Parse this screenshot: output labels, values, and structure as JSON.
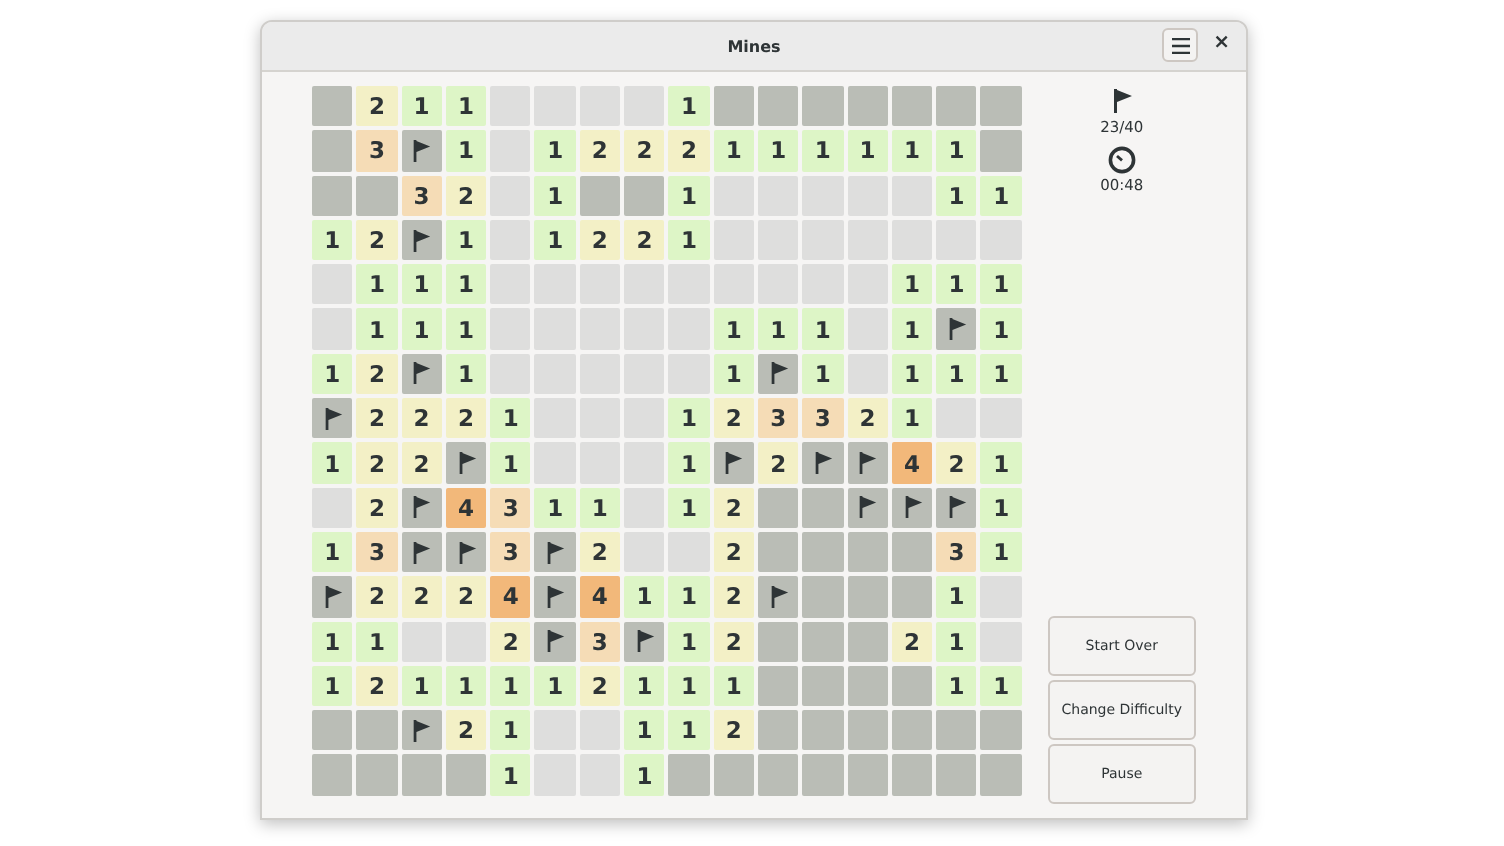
{
  "window": {
    "title": "Mines",
    "close": "×"
  },
  "board": {
    "rows": [
      [
        {
          "kind": "hidden"
        },
        {
          "kind": "number",
          "text": "2",
          "color": "#f3f0c6"
        },
        {
          "kind": "number",
          "text": "1",
          "color": "#ddf5c6"
        },
        {
          "kind": "number",
          "text": "1",
          "color": "#ddf5c6"
        },
        {
          "kind": "open"
        },
        {
          "kind": "open"
        },
        {
          "kind": "open"
        },
        {
          "kind": "open"
        },
        {
          "kind": "number",
          "text": "1",
          "color": "#ddf5c6"
        },
        {
          "kind": "hidden"
        },
        {
          "kind": "hidden"
        },
        {
          "kind": "hidden"
        },
        {
          "kind": "hidden"
        },
        {
          "kind": "hidden"
        },
        {
          "kind": "hidden"
        },
        {
          "kind": "hidden"
        }
      ],
      [
        {
          "kind": "hidden"
        },
        {
          "kind": "number",
          "text": "3",
          "color": "#f5dcb6"
        },
        {
          "kind": "flag"
        },
        {
          "kind": "number",
          "text": "1",
          "color": "#ddf5c6"
        },
        {
          "kind": "open"
        },
        {
          "kind": "number",
          "text": "1",
          "color": "#ddf5c6"
        },
        {
          "kind": "number",
          "text": "2",
          "color": "#f3f0c6"
        },
        {
          "kind": "number",
          "text": "2",
          "color": "#f3f0c6"
        },
        {
          "kind": "number",
          "text": "2",
          "color": "#f3f0c6"
        },
        {
          "kind": "number",
          "text": "1",
          "color": "#ddf5c6"
        },
        {
          "kind": "number",
          "text": "1",
          "color": "#ddf5c6"
        },
        {
          "kind": "number",
          "text": "1",
          "color": "#ddf5c6"
        },
        {
          "kind": "number",
          "text": "1",
          "color": "#ddf5c6"
        },
        {
          "kind": "number",
          "text": "1",
          "color": "#ddf5c6"
        },
        {
          "kind": "number",
          "text": "1",
          "color": "#ddf5c6"
        },
        {
          "kind": "hidden"
        }
      ],
      [
        {
          "kind": "hidden"
        },
        {
          "kind": "hidden"
        },
        {
          "kind": "number",
          "text": "3",
          "color": "#f5dcb6"
        },
        {
          "kind": "number",
          "text": "2",
          "color": "#f3f0c6"
        },
        {
          "kind": "open"
        },
        {
          "kind": "number",
          "text": "1",
          "color": "#ddf5c6"
        },
        {
          "kind": "hidden"
        },
        {
          "kind": "hidden"
        },
        {
          "kind": "number",
          "text": "1",
          "color": "#ddf5c6"
        },
        {
          "kind": "open"
        },
        {
          "kind": "open"
        },
        {
          "kind": "open"
        },
        {
          "kind": "open"
        },
        {
          "kind": "open"
        },
        {
          "kind": "number",
          "text": "1",
          "color": "#ddf5c6"
        },
        {
          "kind": "number",
          "text": "1",
          "color": "#ddf5c6"
        }
      ],
      [
        {
          "kind": "number",
          "text": "1",
          "color": "#ddf5c6"
        },
        {
          "kind": "number",
          "text": "2",
          "color": "#f3f0c6"
        },
        {
          "kind": "flag"
        },
        {
          "kind": "number",
          "text": "1",
          "color": "#ddf5c6"
        },
        {
          "kind": "open"
        },
        {
          "kind": "number",
          "text": "1",
          "color": "#ddf5c6"
        },
        {
          "kind": "number",
          "text": "2",
          "color": "#f3f0c6"
        },
        {
          "kind": "number",
          "text": "2",
          "color": "#f3f0c6"
        },
        {
          "kind": "number",
          "text": "1",
          "color": "#ddf5c6"
        },
        {
          "kind": "open"
        },
        {
          "kind": "open"
        },
        {
          "kind": "open"
        },
        {
          "kind": "open"
        },
        {
          "kind": "open"
        },
        {
          "kind": "open"
        },
        {
          "kind": "open"
        }
      ],
      [
        {
          "kind": "open"
        },
        {
          "kind": "number",
          "text": "1",
          "color": "#ddf5c6"
        },
        {
          "kind": "number",
          "text": "1",
          "color": "#ddf5c6"
        },
        {
          "kind": "number",
          "text": "1",
          "color": "#ddf5c6"
        },
        {
          "kind": "open"
        },
        {
          "kind": "open"
        },
        {
          "kind": "open"
        },
        {
          "kind": "open"
        },
        {
          "kind": "open"
        },
        {
          "kind": "open"
        },
        {
          "kind": "open"
        },
        {
          "kind": "open"
        },
        {
          "kind": "open"
        },
        {
          "kind": "number",
          "text": "1",
          "color": "#ddf5c6"
        },
        {
          "kind": "number",
          "text": "1",
          "color": "#ddf5c6"
        },
        {
          "kind": "number",
          "text": "1",
          "color": "#ddf5c6"
        }
      ],
      [
        {
          "kind": "open"
        },
        {
          "kind": "number",
          "text": "1",
          "color": "#ddf5c6"
        },
        {
          "kind": "number",
          "text": "1",
          "color": "#ddf5c6"
        },
        {
          "kind": "number",
          "text": "1",
          "color": "#ddf5c6"
        },
        {
          "kind": "open"
        },
        {
          "kind": "open"
        },
        {
          "kind": "open"
        },
        {
          "kind": "open"
        },
        {
          "kind": "open"
        },
        {
          "kind": "number",
          "text": "1",
          "color": "#ddf5c6"
        },
        {
          "kind": "number",
          "text": "1",
          "color": "#ddf5c6"
        },
        {
          "kind": "number",
          "text": "1",
          "color": "#ddf5c6"
        },
        {
          "kind": "open"
        },
        {
          "kind": "number",
          "text": "1",
          "color": "#ddf5c6"
        },
        {
          "kind": "flag"
        },
        {
          "kind": "number",
          "text": "1",
          "color": "#ddf5c6"
        }
      ],
      [
        {
          "kind": "number",
          "text": "1",
          "color": "#ddf5c6"
        },
        {
          "kind": "number",
          "text": "2",
          "color": "#f3f0c6"
        },
        {
          "kind": "flag"
        },
        {
          "kind": "number",
          "text": "1",
          "color": "#ddf5c6"
        },
        {
          "kind": "open"
        },
        {
          "kind": "open"
        },
        {
          "kind": "open"
        },
        {
          "kind": "open"
        },
        {
          "kind": "open"
        },
        {
          "kind": "number",
          "text": "1",
          "color": "#ddf5c6"
        },
        {
          "kind": "flag"
        },
        {
          "kind": "number",
          "text": "1",
          "color": "#ddf5c6"
        },
        {
          "kind": "open"
        },
        {
          "kind": "number",
          "text": "1",
          "color": "#ddf5c6"
        },
        {
          "kind": "number",
          "text": "1",
          "color": "#ddf5c6"
        },
        {
          "kind": "number",
          "text": "1",
          "color": "#ddf5c6"
        }
      ],
      [
        {
          "kind": "flag"
        },
        {
          "kind": "number",
          "text": "2",
          "color": "#f3f0c6"
        },
        {
          "kind": "number",
          "text": "2",
          "color": "#f3f0c6"
        },
        {
          "kind": "number",
          "text": "2",
          "color": "#f3f0c6"
        },
        {
          "kind": "number",
          "text": "1",
          "color": "#ddf5c6"
        },
        {
          "kind": "open"
        },
        {
          "kind": "open"
        },
        {
          "kind": "open"
        },
        {
          "kind": "number",
          "text": "1",
          "color": "#ddf5c6"
        },
        {
          "kind": "number",
          "text": "2",
          "color": "#f3f0c6"
        },
        {
          "kind": "number",
          "text": "3",
          "color": "#f5dcb6"
        },
        {
          "kind": "number",
          "text": "3",
          "color": "#f5dcb6"
        },
        {
          "kind": "number",
          "text": "2",
          "color": "#f3f0c6"
        },
        {
          "kind": "number",
          "text": "1",
          "color": "#ddf5c6"
        },
        {
          "kind": "open"
        },
        {
          "kind": "open"
        }
      ],
      [
        {
          "kind": "number",
          "text": "1",
          "color": "#ddf5c6"
        },
        {
          "kind": "number",
          "text": "2",
          "color": "#f3f0c6"
        },
        {
          "kind": "number",
          "text": "2",
          "color": "#f3f0c6"
        },
        {
          "kind": "flag"
        },
        {
          "kind": "number",
          "text": "1",
          "color": "#ddf5c6"
        },
        {
          "kind": "open"
        },
        {
          "kind": "open"
        },
        {
          "kind": "open"
        },
        {
          "kind": "number",
          "text": "1",
          "color": "#ddf5c6"
        },
        {
          "kind": "flag"
        },
        {
          "kind": "number",
          "text": "2",
          "color": "#f3f0c6"
        },
        {
          "kind": "flag"
        },
        {
          "kind": "flag"
        },
        {
          "kind": "number",
          "text": "4",
          "color": "#f2b87a"
        },
        {
          "kind": "number",
          "text": "2",
          "color": "#f3f0c6"
        },
        {
          "kind": "number",
          "text": "1",
          "color": "#ddf5c6"
        }
      ],
      [
        {
          "kind": "open"
        },
        {
          "kind": "number",
          "text": "2",
          "color": "#f3f0c6"
        },
        {
          "kind": "flag"
        },
        {
          "kind": "number",
          "text": "4",
          "color": "#f2b87a"
        },
        {
          "kind": "number",
          "text": "3",
          "color": "#f5dcb6"
        },
        {
          "kind": "number",
          "text": "1",
          "color": "#ddf5c6"
        },
        {
          "kind": "number",
          "text": "1",
          "color": "#ddf5c6"
        },
        {
          "kind": "open"
        },
        {
          "kind": "number",
          "text": "1",
          "color": "#ddf5c6"
        },
        {
          "kind": "number",
          "text": "2",
          "color": "#f3f0c6"
        },
        {
          "kind": "hidden"
        },
        {
          "kind": "hidden"
        },
        {
          "kind": "flag"
        },
        {
          "kind": "flag"
        },
        {
          "kind": "flag"
        },
        {
          "kind": "number",
          "text": "1",
          "color": "#ddf5c6"
        }
      ],
      [
        {
          "kind": "number",
          "text": "1",
          "color": "#ddf5c6"
        },
        {
          "kind": "number",
          "text": "3",
          "color": "#f5dcb6"
        },
        {
          "kind": "flag"
        },
        {
          "kind": "flag"
        },
        {
          "kind": "number",
          "text": "3",
          "color": "#f5dcb6"
        },
        {
          "kind": "flag"
        },
        {
          "kind": "number",
          "text": "2",
          "color": "#f3f0c6"
        },
        {
          "kind": "open"
        },
        {
          "kind": "open"
        },
        {
          "kind": "number",
          "text": "2",
          "color": "#f3f0c6"
        },
        {
          "kind": "hidden"
        },
        {
          "kind": "hidden"
        },
        {
          "kind": "hidden"
        },
        {
          "kind": "hidden"
        },
        {
          "kind": "number",
          "text": "3",
          "color": "#f5dcb6"
        },
        {
          "kind": "number",
          "text": "1",
          "color": "#ddf5c6"
        }
      ],
      [
        {
          "kind": "flag"
        },
        {
          "kind": "number",
          "text": "2",
          "color": "#f3f0c6"
        },
        {
          "kind": "number",
          "text": "2",
          "color": "#f3f0c6"
        },
        {
          "kind": "number",
          "text": "2",
          "color": "#f3f0c6"
        },
        {
          "kind": "number",
          "text": "4",
          "color": "#f2b87a"
        },
        {
          "kind": "flag"
        },
        {
          "kind": "number",
          "text": "4",
          "color": "#f2b87a"
        },
        {
          "kind": "number",
          "text": "1",
          "color": "#ddf5c6"
        },
        {
          "kind": "number",
          "text": "1",
          "color": "#ddf5c6"
        },
        {
          "kind": "number",
          "text": "2",
          "color": "#f3f0c6"
        },
        {
          "kind": "flag"
        },
        {
          "kind": "hidden"
        },
        {
          "kind": "hidden"
        },
        {
          "kind": "hidden"
        },
        {
          "kind": "number",
          "text": "1",
          "color": "#ddf5c6"
        },
        {
          "kind": "open"
        }
      ],
      [
        {
          "kind": "number",
          "text": "1",
          "color": "#ddf5c6"
        },
        {
          "kind": "number",
          "text": "1",
          "color": "#ddf5c6"
        },
        {
          "kind": "open"
        },
        {
          "kind": "open"
        },
        {
          "kind": "number",
          "text": "2",
          "color": "#f3f0c6"
        },
        {
          "kind": "flag"
        },
        {
          "kind": "number",
          "text": "3",
          "color": "#f5dcb6"
        },
        {
          "kind": "flag"
        },
        {
          "kind": "number",
          "text": "1",
          "color": "#ddf5c6"
        },
        {
          "kind": "number",
          "text": "2",
          "color": "#f3f0c6"
        },
        {
          "kind": "hidden"
        },
        {
          "kind": "hidden"
        },
        {
          "kind": "hidden"
        },
        {
          "kind": "number",
          "text": "2",
          "color": "#f3f0c6"
        },
        {
          "kind": "number",
          "text": "1",
          "color": "#ddf5c6"
        },
        {
          "kind": "open"
        }
      ],
      [
        {
          "kind": "number",
          "text": "1",
          "color": "#ddf5c6"
        },
        {
          "kind": "number",
          "text": "2",
          "color": "#f3f0c6"
        },
        {
          "kind": "number",
          "text": "1",
          "color": "#ddf5c6"
        },
        {
          "kind": "number",
          "text": "1",
          "color": "#ddf5c6"
        },
        {
          "kind": "number",
          "text": "1",
          "color": "#ddf5c6"
        },
        {
          "kind": "number",
          "text": "1",
          "color": "#ddf5c6"
        },
        {
          "kind": "number",
          "text": "2",
          "color": "#f3f0c6"
        },
        {
          "kind": "number",
          "text": "1",
          "color": "#ddf5c6"
        },
        {
          "kind": "number",
          "text": "1",
          "color": "#ddf5c6"
        },
        {
          "kind": "number",
          "text": "1",
          "color": "#ddf5c6"
        },
        {
          "kind": "hidden"
        },
        {
          "kind": "hidden"
        },
        {
          "kind": "hidden"
        },
        {
          "kind": "hidden"
        },
        {
          "kind": "number",
          "text": "1",
          "color": "#ddf5c6"
        },
        {
          "kind": "number",
          "text": "1",
          "color": "#ddf5c6"
        }
      ],
      [
        {
          "kind": "hidden"
        },
        {
          "kind": "hidden"
        },
        {
          "kind": "flag"
        },
        {
          "kind": "number",
          "text": "2",
          "color": "#f3f0c6"
        },
        {
          "kind": "number",
          "text": "1",
          "color": "#ddf5c6"
        },
        {
          "kind": "open"
        },
        {
          "kind": "open"
        },
        {
          "kind": "number",
          "text": "1",
          "color": "#ddf5c6"
        },
        {
          "kind": "number",
          "text": "1",
          "color": "#ddf5c6"
        },
        {
          "kind": "number",
          "text": "2",
          "color": "#f3f0c6"
        },
        {
          "kind": "hidden"
        },
        {
          "kind": "hidden"
        },
        {
          "kind": "hidden"
        },
        {
          "kind": "hidden"
        },
        {
          "kind": "hidden"
        },
        {
          "kind": "hidden"
        }
      ],
      [
        {
          "kind": "hidden"
        },
        {
          "kind": "hidden"
        },
        {
          "kind": "hidden"
        },
        {
          "kind": "hidden"
        },
        {
          "kind": "number",
          "text": "1",
          "color": "#ddf5c6"
        },
        {
          "kind": "open"
        },
        {
          "kind": "open"
        },
        {
          "kind": "number",
          "text": "1",
          "color": "#ddf5c6"
        },
        {
          "kind": "hidden"
        },
        {
          "kind": "hidden"
        },
        {
          "kind": "hidden"
        },
        {
          "kind": "hidden"
        },
        {
          "kind": "hidden"
        },
        {
          "kind": "hidden"
        },
        {
          "kind": "hidden"
        },
        {
          "kind": "hidden"
        }
      ]
    ]
  },
  "status": {
    "flags": "23/40",
    "time": "00:48"
  },
  "buttons": [
    "Start Over",
    "Change Difficulty",
    "Pause"
  ]
}
